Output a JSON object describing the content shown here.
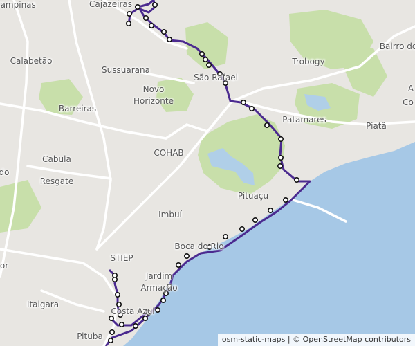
{
  "map": {
    "colors": {
      "land": "#e8e6e2",
      "sea": "#a6c8e6",
      "park": "#c8dfaa",
      "water": "#b0cfe8",
      "road": "#ffffff",
      "route": "#4b2a8f",
      "stop_fill": "#ffffff",
      "stop_stroke": "#111111"
    },
    "labels": [
      "Campinas",
      "Cajazeiras",
      "Calabetão",
      "Sussuarana",
      "Novo",
      "Horizonte",
      "Trobogy",
      "Bairro do",
      "São Rafael",
      "Barreiras",
      "Patamares",
      "Piatã",
      "A",
      "Co",
      "Cabula",
      "Resgate",
      "COHAB",
      "do",
      "Pituaçu",
      "Imbuí",
      "STIEP",
      "Boca do Rio",
      "Jardim",
      "Armação",
      "or",
      "Itaigara",
      "Costa Azul",
      "Pituba"
    ],
    "attribution": "osm-static-maps | © OpenStreetMap contributors"
  }
}
